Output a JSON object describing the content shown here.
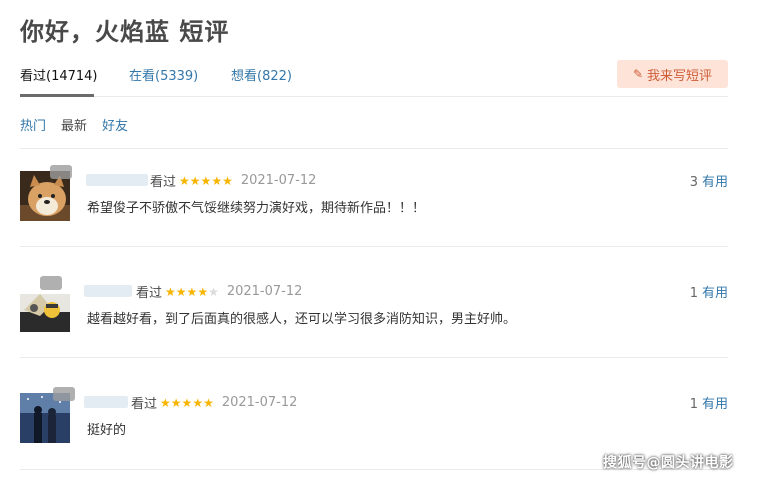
{
  "page": {
    "title": "你好，火焰蓝 短评"
  },
  "tabs": [
    {
      "label": "看过(14714)",
      "active": true
    },
    {
      "label": "在看(5339)",
      "active": false
    },
    {
      "label": "想看(822)",
      "active": false
    }
  ],
  "write_button": {
    "label": "我来写短评",
    "icon": "pencil-icon"
  },
  "filters": [
    {
      "label": "热门"
    },
    {
      "label": "最新"
    },
    {
      "label": "好友"
    }
  ],
  "reviews": [
    {
      "status": "看过",
      "rating": 5,
      "date": "2021-07-12",
      "votes": "3",
      "useful_label": "有用",
      "comment": "希望俊子不骄傲不气馁继续努力演好戏，期待新作品！！！"
    },
    {
      "status": "看过",
      "rating": 4,
      "date": "2021-07-12",
      "votes": "1",
      "useful_label": "有用",
      "comment": "越看越好看，到了后面真的很感人，还可以学习很多消防知识，男主好帅。"
    },
    {
      "status": "看过",
      "rating": 5,
      "date": "2021-07-12",
      "votes": "1",
      "useful_label": "有用",
      "comment": "挺好的"
    }
  ],
  "watermark": "搜狐号@圆头讲电影",
  "colors": {
    "link": "#3377aa",
    "star": "#f7b500",
    "button_bg": "#fde3d8",
    "button_text": "#ce5d38"
  }
}
